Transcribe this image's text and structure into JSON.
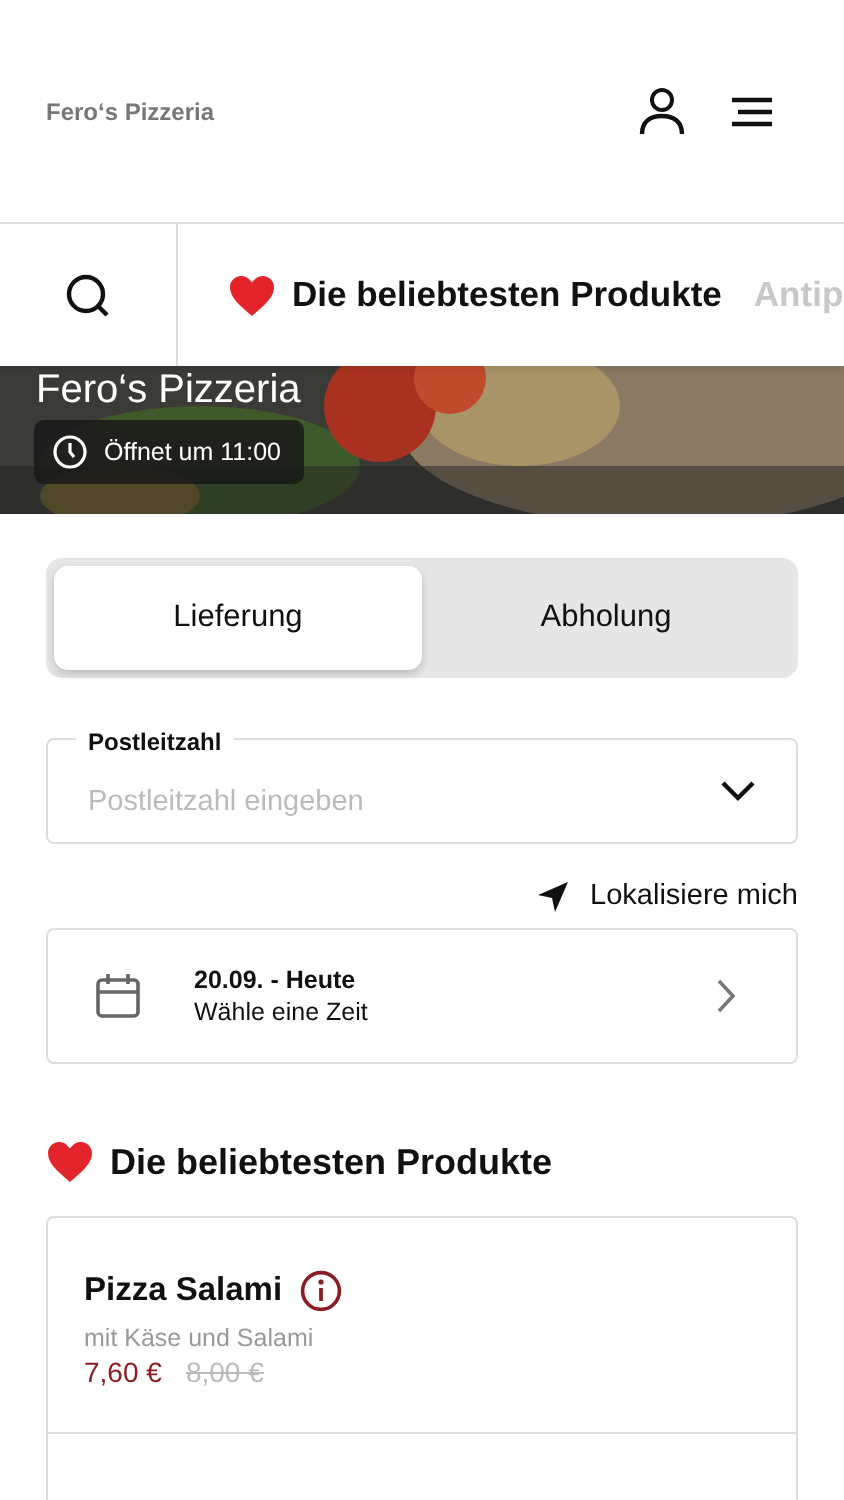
{
  "header": {
    "title": "Fero‘s Pizzeria"
  },
  "category_nav": [
    {
      "label": "Die beliebtesten Produkte",
      "selected": true
    },
    {
      "label": "Antip",
      "selected": false
    }
  ],
  "hero": {
    "title": "Fero‘s Pizzeria",
    "opening": "Öffnet um 11:00"
  },
  "mode_tabs": [
    {
      "label": "Lieferung",
      "selected": true
    },
    {
      "label": "Abholung",
      "selected": false
    }
  ],
  "postcode": {
    "label": "Postleitzahl",
    "placeholder": "Postleitzahl eingeben"
  },
  "locate": "Lokalisiere mich",
  "date": {
    "title": "20.09. - Heute",
    "subtitle": "Wähle eine Zeit"
  },
  "section_title": "Die beliebtesten Produkte",
  "products": [
    {
      "name": "Pizza Salami",
      "description": "mit Käse und Salami",
      "price": "7,60 €",
      "old_price": "8,00 €"
    }
  ]
}
